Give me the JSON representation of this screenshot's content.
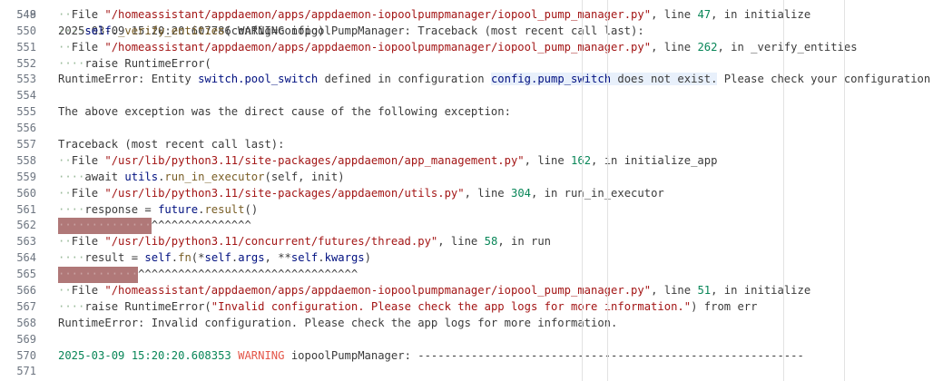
{
  "lines": [
    {
      "n": "549",
      "segs": [
        [
          "ws",
          "··"
        ],
        [
          "t",
          "File "
        ],
        [
          "s",
          "\"/homeassistant/appdaemon/apps/appdaemon-iopoolpumpmanager/iopool_pump_manager.py\""
        ],
        [
          "t",
          ", line "
        ],
        [
          "n",
          "47"
        ],
        [
          "t",
          ", in initialize"
        ]
      ]
    },
    {
      "n": "550",
      "segs": [
        [
          "ws",
          "····"
        ],
        [
          "v",
          "self"
        ],
        [
          "t",
          "."
        ],
        [
          "f",
          "_verify_entities"
        ],
        [
          "t",
          "(config=config)"
        ]
      ]
    },
    {
      "n": "551",
      "segs": [
        [
          "ws",
          "··"
        ],
        [
          "t",
          "File "
        ],
        [
          "s",
          "\"/homeassistant/appdaemon/apps/appdaemon-iopoolpumpmanager/iopool_pump_manager.py\""
        ],
        [
          "t",
          ", line "
        ],
        [
          "n",
          "262"
        ],
        [
          "t",
          ", in _verify_entities"
        ]
      ]
    },
    {
      "n": "552",
      "segs": [
        [
          "ws",
          "····"
        ],
        [
          "t",
          "raise RuntimeError("
        ]
      ]
    },
    {
      "n": "553",
      "segs": [
        [
          "t",
          "RuntimeError: Entity "
        ],
        [
          "v",
          "switch.pool_switch"
        ],
        [
          "t",
          " defined in configuration "
        ],
        [
          "vh",
          "config.pump_switch"
        ],
        [
          "th",
          " does not exist."
        ],
        [
          "t",
          " Please check your configuration."
        ]
      ]
    },
    {
      "n": "554",
      "segs": []
    },
    {
      "n": "555",
      "segs": [
        [
          "t",
          "The above exception was the direct cause of the following exception:"
        ]
      ]
    },
    {
      "n": "556",
      "segs": []
    },
    {
      "n": "557",
      "segs": [
        [
          "t",
          "Traceback (most recent call last):"
        ]
      ]
    },
    {
      "n": "558",
      "segs": [
        [
          "ws",
          "··"
        ],
        [
          "t",
          "File "
        ],
        [
          "s",
          "\"/usr/lib/python3.11/site-packages/appdaemon/app_management.py\""
        ],
        [
          "t",
          ", line "
        ],
        [
          "n",
          "162"
        ],
        [
          "t",
          ", in initialize_app"
        ]
      ]
    },
    {
      "n": "559",
      "segs": [
        [
          "ws",
          "····"
        ],
        [
          "t",
          "await "
        ],
        [
          "v",
          "utils"
        ],
        [
          "t",
          "."
        ],
        [
          "f",
          "run_in_executor"
        ],
        [
          "t",
          "(self, init)"
        ]
      ]
    },
    {
      "n": "560",
      "segs": [
        [
          "ws",
          "··"
        ],
        [
          "t",
          "File "
        ],
        [
          "s",
          "\"/usr/lib/python3.11/site-packages/appdaemon/utils.py\""
        ],
        [
          "t",
          ", line "
        ],
        [
          "n",
          "304"
        ],
        [
          "t",
          ", in run_in_executor"
        ]
      ]
    },
    {
      "n": "561",
      "segs": [
        [
          "ws",
          "····"
        ],
        [
          "t",
          "response = "
        ],
        [
          "v",
          "future"
        ],
        [
          "t",
          "."
        ],
        [
          "f",
          "result"
        ],
        [
          "t",
          "()"
        ]
      ]
    },
    {
      "n": "562",
      "segs": [
        [
          "err",
          "··············"
        ],
        [
          "t",
          "^^^^^^^^^^^^^^^"
        ]
      ]
    },
    {
      "n": "563",
      "segs": [
        [
          "ws",
          "··"
        ],
        [
          "t",
          "File "
        ],
        [
          "s",
          "\"/usr/lib/python3.11/concurrent/futures/thread.py\""
        ],
        [
          "t",
          ", line "
        ],
        [
          "n",
          "58"
        ],
        [
          "t",
          ", in run"
        ]
      ]
    },
    {
      "n": "564",
      "segs": [
        [
          "ws",
          "····"
        ],
        [
          "t",
          "result = "
        ],
        [
          "v",
          "self"
        ],
        [
          "t",
          "."
        ],
        [
          "f",
          "fn"
        ],
        [
          "t",
          "(*"
        ],
        [
          "v",
          "self"
        ],
        [
          "t",
          "."
        ],
        [
          "v",
          "args"
        ],
        [
          "t",
          ", **"
        ],
        [
          "v",
          "self"
        ],
        [
          "t",
          "."
        ],
        [
          "v",
          "kwargs"
        ],
        [
          "t",
          ")"
        ]
      ]
    },
    {
      "n": "565",
      "segs": [
        [
          "err",
          "············"
        ],
        [
          "t",
          "^^^^^^^^^^^^^^^^^^^^^^^^^^^^^^^^^"
        ]
      ]
    },
    {
      "n": "566",
      "segs": [
        [
          "ws",
          "··"
        ],
        [
          "t",
          "File "
        ],
        [
          "s",
          "\"/homeassistant/appdaemon/apps/appdaemon-iopoolpumpmanager/iopool_pump_manager.py\""
        ],
        [
          "t",
          ", line "
        ],
        [
          "n",
          "51"
        ],
        [
          "t",
          ", in initialize"
        ]
      ]
    },
    {
      "n": "567",
      "segs": [
        [
          "ws",
          "····"
        ],
        [
          "t",
          "raise RuntimeError("
        ],
        [
          "s",
          "\"Invalid configuration. Please check the app logs for more information.\""
        ],
        [
          "t",
          ") from err"
        ]
      ]
    },
    {
      "n": "568",
      "segs": [
        [
          "t",
          "RuntimeError: Invalid configuration. Please check the app logs for more information."
        ]
      ]
    },
    {
      "n": "569",
      "segs": []
    },
    {
      "n": "570",
      "segs": [
        [
          "ts",
          "2025-03-09 15:20:20.608353"
        ],
        [
          "t",
          " "
        ],
        [
          "warn",
          "WARNING"
        ],
        [
          "t",
          " iopoolPumpManager: ----------------------------------------------------------"
        ]
      ]
    },
    {
      "n": "571",
      "segs": []
    }
  ],
  "top_partial": {
    "n": "548",
    "text": "2025-03-09 15:20:20.607786 WARNING iopoolPumpManager: Traceback (most recent call last):"
  },
  "colors": {
    "background": "#ffffff",
    "string": "#a31515",
    "number": "#098658",
    "identifier": "#001080",
    "function": "#795e26",
    "warning": "#e45649",
    "error_squiggle": "#b07878"
  }
}
